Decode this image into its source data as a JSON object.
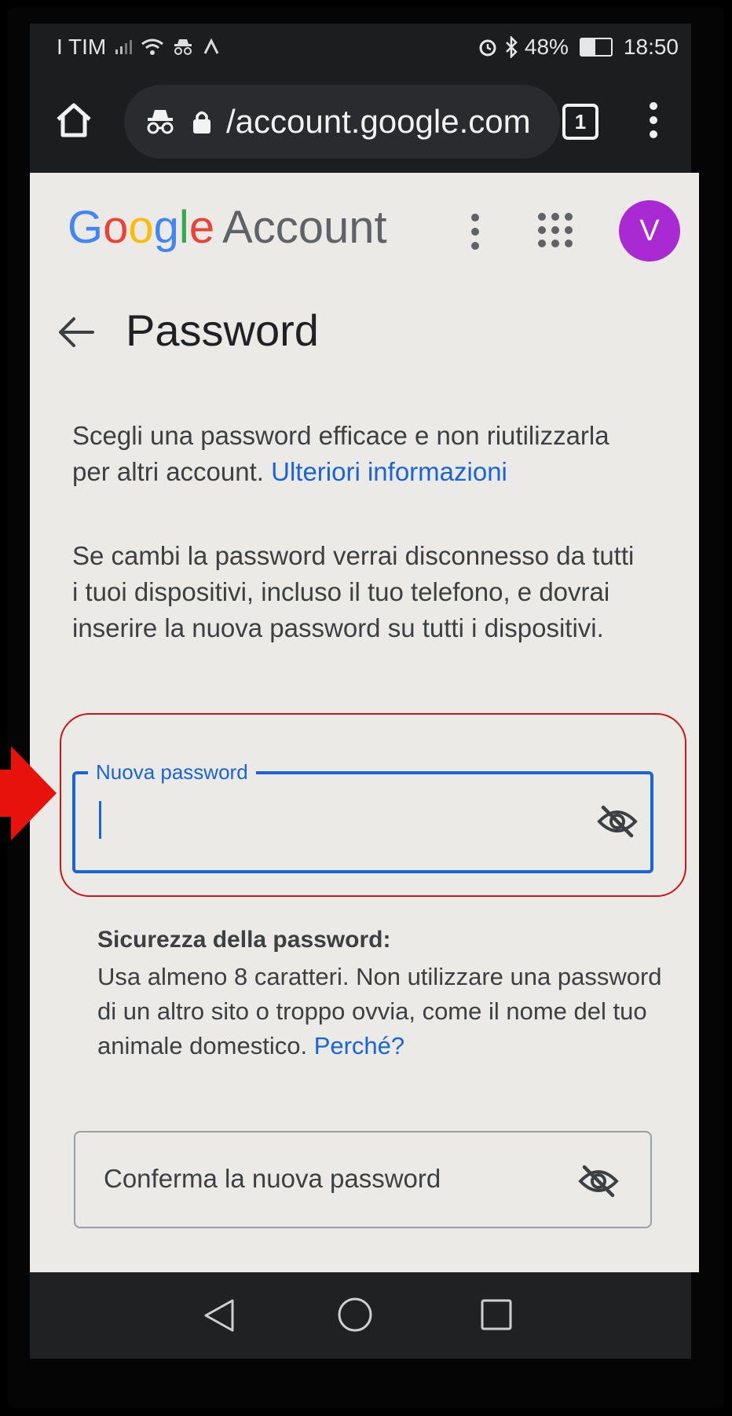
{
  "status_bar": {
    "carrier": "I TIM",
    "battery_percent": "48%",
    "battery_level": 0.48,
    "time": "18:50"
  },
  "browser": {
    "url": "/account.google.com",
    "tab_count": "1"
  },
  "header": {
    "logo_letters": [
      {
        "char": "G",
        "color": "#4285F4"
      },
      {
        "char": "o",
        "color": "#EA4335"
      },
      {
        "char": "o",
        "color": "#FBBC05"
      },
      {
        "char": "g",
        "color": "#4285F4"
      },
      {
        "char": "l",
        "color": "#34A853"
      },
      {
        "char": "e",
        "color": "#EA4335"
      }
    ],
    "product": "Account",
    "avatar_initial": "V",
    "avatar_color": "#A92AD3"
  },
  "page": {
    "title": "Password",
    "intro_text": "Scegli una password efficace e non riutilizzarla per altri account. ",
    "intro_link": "Ulteriori informazioni",
    "warning_text": "Se cambi la password verrai disconnesso da tutti i tuoi dispositivi, incluso il tuo telefono, e dovrai inserire la nuova password su tutti i dispositivi.",
    "new_password_label": "Nuova password",
    "strength_title": "Sicurezza della password:",
    "strength_text": "Usa almeno 8 caratteri. Non utilizzare una password di un altro sito o troppo ovvia, come il nome del tuo animale domestico. ",
    "strength_link": "Perché?",
    "confirm_placeholder": "Conferma la nuova password"
  },
  "colors": {
    "accent": "#1A64D6",
    "highlight_border": "#C91717",
    "arrow": "#E8120C"
  }
}
